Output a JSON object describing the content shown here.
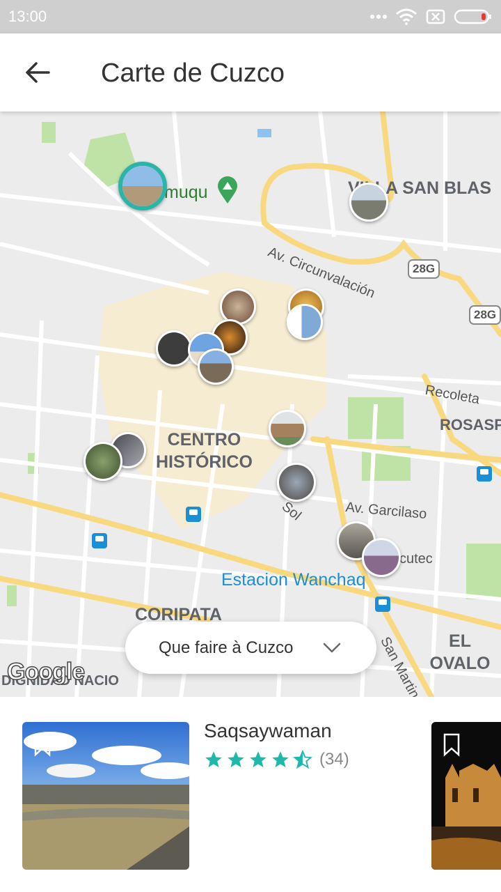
{
  "status_bar": {
    "time": "13:00"
  },
  "app_bar": {
    "title": "Carte de Cuzco"
  },
  "map": {
    "labels": {
      "muqu": "muqu",
      "villa_san_blas": "VILLA SAN BLAS",
      "av_circunvalacion": "Av. Circunvalación",
      "route_28g_a": "28G",
      "route_28g_b": "28G",
      "recoleta": "Recoleta",
      "rosaspata": "ROSASPA",
      "centro_historico": "CENTRO\nHISTÓRICO",
      "av_garcilaso": "Av. Garcilaso",
      "sol": "Sol",
      "cutec": "cutec",
      "estacion_wanchaq": "Estacion Wanchaq",
      "coripata": "CORIPATA",
      "el_ovalo": "EL OVALO",
      "san_martin": "San Martin",
      "dignidad_nacional": "DIGNIDAD NACIONAL"
    },
    "attribution": "Google",
    "category_selector": "Que faire à Cuzco"
  },
  "card": {
    "title": "Saqsaywaman",
    "rating": 4.5,
    "reviews": "(34)"
  },
  "colors": {
    "accent": "#2bb5a8",
    "star": "#1fb8ad",
    "map_bg": "#ececec",
    "road_major": "#f9d980",
    "park": "#bfe3a6"
  }
}
